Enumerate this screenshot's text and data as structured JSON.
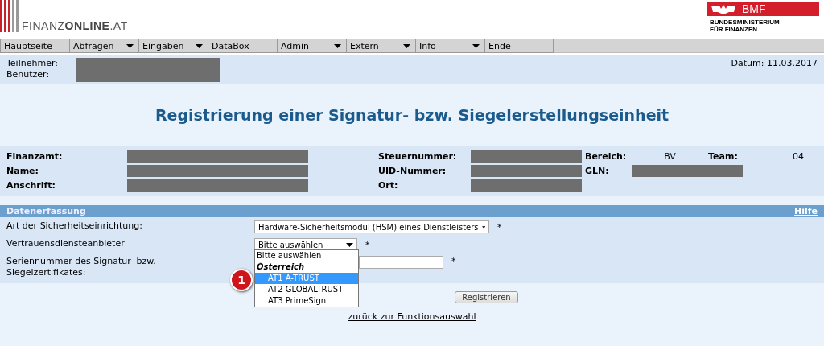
{
  "header": {
    "logo": {
      "prefix": "FINANZ",
      "bold": "ONLINE",
      "suffix": ".AT"
    },
    "ministry": {
      "badge": "BMF",
      "name_line1": "BUNDESMINISTERIUM",
      "name_line2": "FÜR FINANZEN"
    }
  },
  "nav": [
    {
      "label": "Hauptseite",
      "has_menu": false
    },
    {
      "label": "Abfragen",
      "has_menu": true
    },
    {
      "label": "Eingaben",
      "has_menu": true
    },
    {
      "label": "DataBox",
      "has_menu": false
    },
    {
      "label": "Admin",
      "has_menu": true
    },
    {
      "label": "Extern",
      "has_menu": true
    },
    {
      "label": "Info",
      "has_menu": true
    },
    {
      "label": "Ende",
      "has_menu": false
    }
  ],
  "user_info": {
    "participant_label": "Teilnehmer:",
    "user_label": "Benutzer:",
    "date": "Datum: 11.03.2017"
  },
  "title": "Registrierung einer Signatur- bzw. Siegelerstellungseinheit",
  "details": [
    {
      "label": "Finanzamt:",
      "redacted": true
    },
    {
      "label": "Steuernummer:",
      "redacted": true
    },
    {
      "label": "Bereich:",
      "value": "BV"
    },
    {
      "label": "Team:",
      "value": "04"
    },
    {
      "label": "Name:",
      "redacted": true
    },
    {
      "label": "UID-Nummer:",
      "redacted": true
    },
    {
      "label": "GLN:",
      "redacted": true
    },
    {
      "label": "Anschrift:",
      "redacted": true
    },
    {
      "label": "Ort:",
      "redacted": true
    }
  ],
  "section": {
    "title": "Datenerfassung",
    "help": "Hilfe"
  },
  "form": {
    "device_label": "Art der Sicherheitseinrichtung:",
    "device_value": "Hardware-Sicherheitsmodul (HSM) eines Dienstleisters",
    "provider_label": "Vertrauensdiensteanbieter",
    "provider_value": "Bitte auswählen",
    "serial_label": "Seriennummer des Signatur- bzw. Siegelzertifikates:",
    "required": "*",
    "submit": "Registrieren"
  },
  "dropdown": [
    {
      "label": "Bitte auswählen",
      "kind": "option",
      "selected": false
    },
    {
      "label": "Österreich",
      "kind": "group",
      "selected": false
    },
    {
      "label": "AT1 A-TRUST",
      "kind": "option",
      "selected": true
    },
    {
      "label": "AT2 GLOBALTRUST",
      "kind": "option",
      "selected": false
    },
    {
      "label": "AT3 PrimeSign",
      "kind": "option",
      "selected": false
    }
  ],
  "callout": "1",
  "back_link": "zurück zur Funktionsauswahl"
}
